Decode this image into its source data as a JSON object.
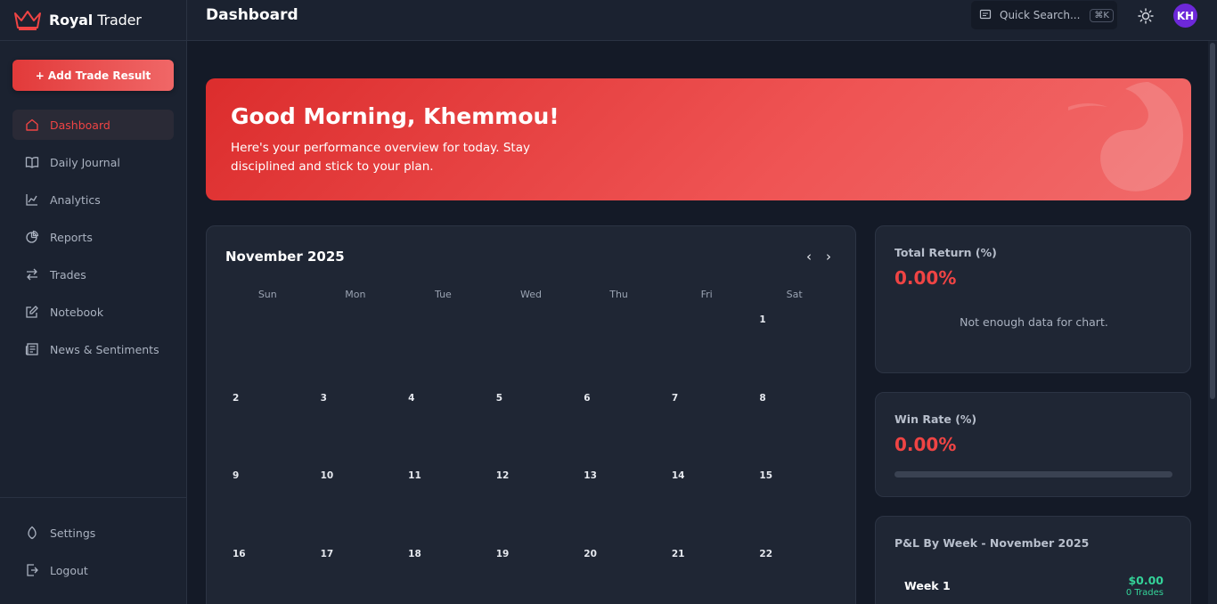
{
  "brand": {
    "name_bold": "Royal",
    "name_light": "Trader",
    "accent": "#ef4444"
  },
  "sidebar": {
    "add_button": "+ Add Trade Result",
    "items": [
      {
        "label": "Dashboard",
        "icon": "home-icon",
        "active": true
      },
      {
        "label": "Daily Journal",
        "icon": "book-icon"
      },
      {
        "label": "Analytics",
        "icon": "analytics-icon"
      },
      {
        "label": "Reports",
        "icon": "pie-chart-icon"
      },
      {
        "label": "Trades",
        "icon": "arrows-exchange-icon"
      },
      {
        "label": "Notebook",
        "icon": "edit-icon"
      },
      {
        "label": "News & Sentiments",
        "icon": "newspaper-icon"
      }
    ],
    "footer": [
      {
        "label": "Settings",
        "icon": "settings-icon"
      },
      {
        "label": "Logout",
        "icon": "logout-icon"
      }
    ]
  },
  "header": {
    "title": "Dashboard",
    "search_label": "Quick Search...",
    "search_shortcut": "⌘K",
    "avatar_initials": "KH"
  },
  "hero": {
    "greeting": "Good Morning, Khemmou!",
    "subtitle": "Here's your performance overview for today. Stay disciplined and stick to your plan."
  },
  "calendar": {
    "month": "November 2025",
    "weekdays": [
      "Sun",
      "Mon",
      "Tue",
      "Wed",
      "Thu",
      "Fri",
      "Sat"
    ],
    "days": [
      "",
      "",
      "",
      "",
      "",
      "",
      "1",
      "2",
      "3",
      "4",
      "5",
      "6",
      "7",
      "8",
      "9",
      "10",
      "11",
      "12",
      "13",
      "14",
      "15",
      "16",
      "17",
      "18",
      "19",
      "20",
      "21",
      "22"
    ]
  },
  "stats": {
    "total_return": {
      "title": "Total Return (%)",
      "value": "0.00%",
      "empty": "Not enough data for chart."
    },
    "win_rate": {
      "title": "Win Rate (%)",
      "value": "0.00%",
      "progress": 0
    },
    "pnl": {
      "title": "P&L By Week - November 2025",
      "weeks": [
        {
          "label": "Week 1",
          "amount": "$0.00",
          "trades": "0 Trades"
        }
      ]
    }
  }
}
